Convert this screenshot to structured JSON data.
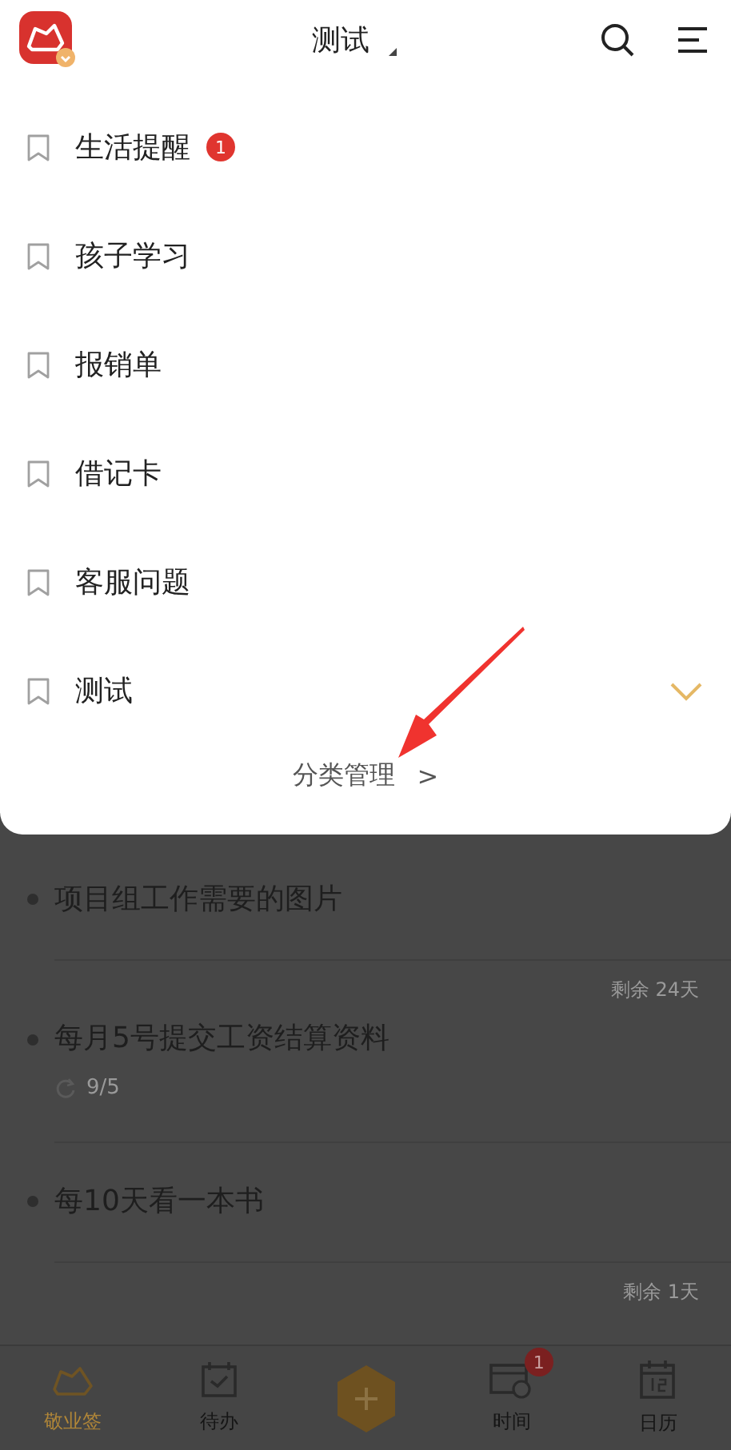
{
  "header": {
    "title": "测试"
  },
  "categories": [
    {
      "name": "生活提醒",
      "badge": "1",
      "selected": false
    },
    {
      "name": "孩子学习",
      "selected": false
    },
    {
      "name": "报销单",
      "selected": false
    },
    {
      "name": "借记卡",
      "selected": false
    },
    {
      "name": "客服问题",
      "selected": false
    },
    {
      "name": "测试",
      "selected": true
    }
  ],
  "manage_link": {
    "label": "分类管理",
    "chevron": ">"
  },
  "tasks": [
    {
      "title": "项目组工作需要的图片"
    },
    {
      "remaining": "剩余 24天",
      "title": "每月5号提交工资结算资料",
      "progress": "9/5"
    },
    {
      "title": "每10天看一本书"
    },
    {
      "remaining": "剩余 1天"
    }
  ],
  "tab_bar": [
    {
      "kind": "tab",
      "label": "敬业签",
      "selected": true
    },
    {
      "kind": "tab",
      "label": "待办",
      "selected": false
    },
    {
      "kind": "add"
    },
    {
      "kind": "tab",
      "label": "时间",
      "badge": "1",
      "selected": false
    },
    {
      "kind": "tab",
      "label": "日历",
      "selected": false
    }
  ]
}
